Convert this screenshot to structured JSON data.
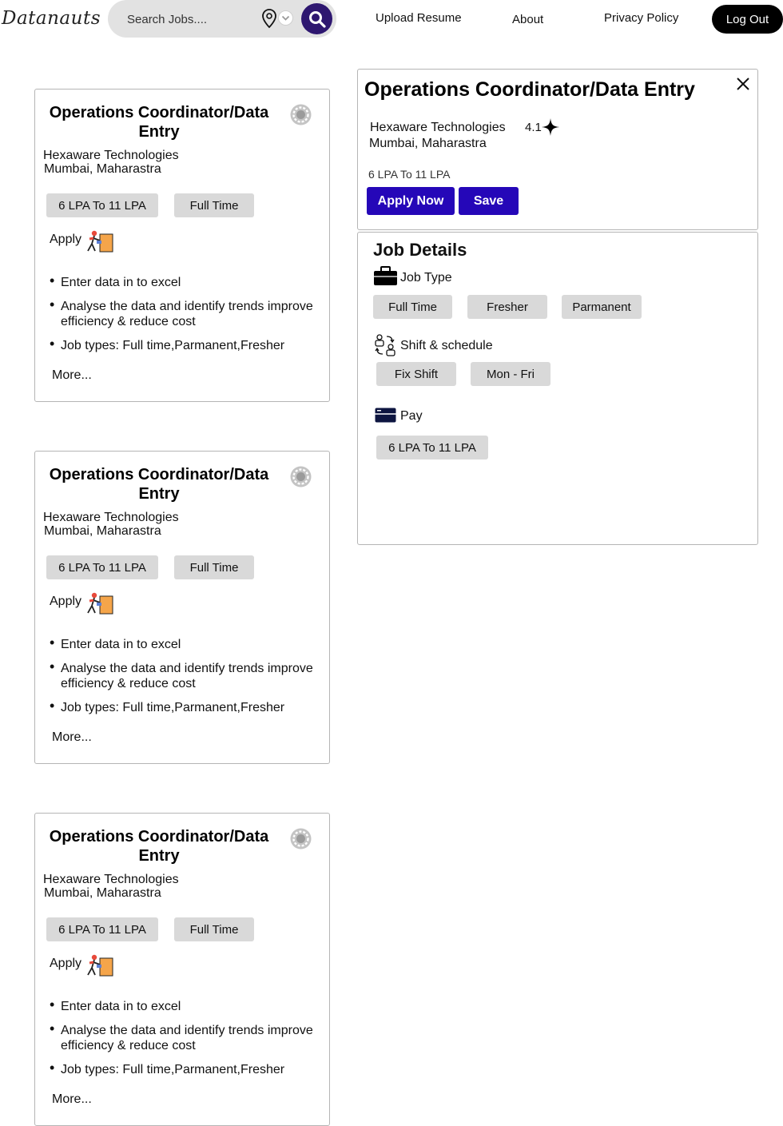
{
  "header": {
    "logo": "Datanauts",
    "search": {
      "placeholder": "Search Jobs...."
    },
    "nav": [
      "Upload Resume",
      "About",
      "Privacy Policy"
    ],
    "logout_label": "Log Out"
  },
  "job_cards": [
    {
      "title": "Operations Coordinator/Data Entry",
      "company": "Hexaware Technologies",
      "location": "Mumbai, Maharastra",
      "salary_chip": "6 LPA To 11 LPA",
      "type_chip": "Full Time",
      "apply_label": "Apply",
      "bullets": [
        "Enter data in to excel",
        "Analyse the data and identify trends improve efficiency & reduce cost",
        "Job types: Full time,Parmanent,Fresher"
      ],
      "more_label": "More..."
    },
    {
      "title": "Operations Coordinator/Data Entry",
      "company": "Hexaware Technologies",
      "location": "Mumbai, Maharastra",
      "salary_chip": "6 LPA To 11 LPA",
      "type_chip": "Full Time",
      "apply_label": "Apply",
      "bullets": [
        "Enter data in to excel",
        "Analyse the data and identify trends improve efficiency & reduce cost",
        "Job types: Full time,Parmanent,Fresher"
      ],
      "more_label": "More..."
    },
    {
      "title": "Operations Coordinator/Data Entry",
      "company": "Hexaware Technologies",
      "location": "Mumbai, Maharastra",
      "salary_chip": "6 LPA To 11 LPA",
      "type_chip": "Full Time",
      "apply_label": "Apply",
      "bullets": [
        "Enter data in to excel",
        "Analyse the data and identify trends improve efficiency & reduce cost",
        "Job types: Full time,Parmanent,Fresher"
      ],
      "more_label": "More..."
    }
  ],
  "detail": {
    "title": "Operations Coordinator/Data Entry",
    "company": "Hexaware Technologies",
    "rating": "4.1",
    "location": "Mumbai, Maharastra",
    "salary": "6 LPA To 11 LPA",
    "apply_label": "Apply Now",
    "save_label": "Save",
    "job_details_heading": "Job Details",
    "job_type_label": "Job Type",
    "job_type_chips": [
      "Full Time",
      "Fresher",
      "Parmanent"
    ],
    "schedule_label": "Shift & schedule",
    "schedule_chips": [
      "Fix Shift",
      "Mon - Fri"
    ],
    "pay_label": "Pay",
    "pay_chips": [
      "6 LPA To 11 LPA"
    ]
  },
  "colors": {
    "accent": "#2507b8",
    "search_button": "#2e1770",
    "chip_bg": "#d9d9d9",
    "search_bar_bg": "#e2e2e2"
  },
  "icons": [
    "location-pin-icon",
    "chevron-down-icon",
    "search-icon",
    "gear-icon",
    "apply-person-icon",
    "close-icon",
    "star-icon",
    "briefcase-icon",
    "schedule-people-icon",
    "card-icon"
  ]
}
